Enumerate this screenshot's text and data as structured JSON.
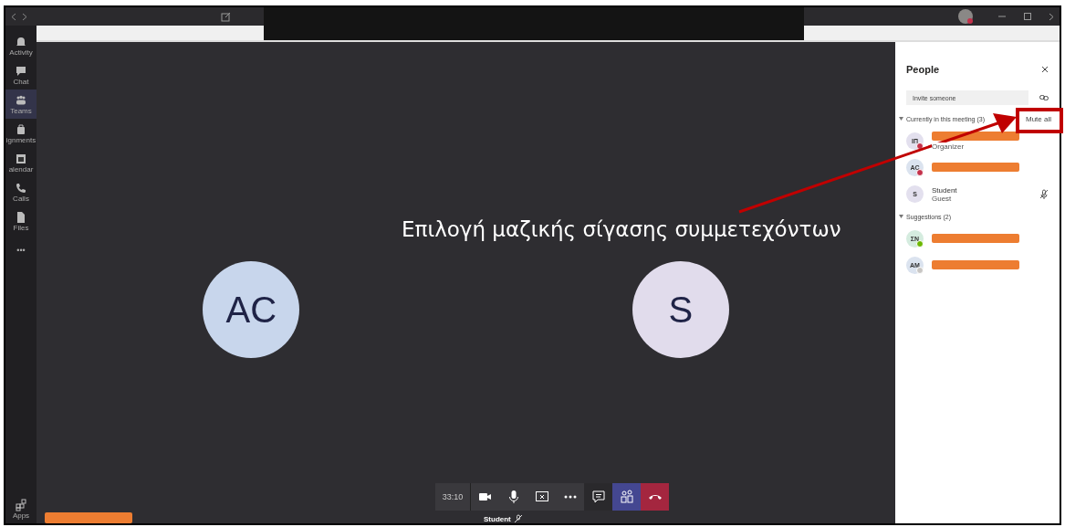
{
  "rail": [
    {
      "label": "Activity",
      "selected": false
    },
    {
      "label": "Chat",
      "selected": false
    },
    {
      "label": "Teams",
      "selected": true
    },
    {
      "label": "ignments",
      "selected": false
    },
    {
      "label": "alendar",
      "selected": false
    },
    {
      "label": "Calls",
      "selected": false
    },
    {
      "label": "Files",
      "selected": false
    },
    {
      "label": "•••",
      "selected": false
    }
  ],
  "rail_bottom": {
    "label": "Apps"
  },
  "stage": {
    "participants": [
      {
        "initials": "AC",
        "kind": "blue"
      },
      {
        "initials": "S",
        "kind": "lilac"
      }
    ],
    "annotation": "Επιλογή μαζικής σίγασης συμμετεχόντων",
    "timer": "33:10",
    "controls": [
      {
        "kind": "plain"
      },
      {
        "kind": "plain"
      },
      {
        "kind": "plain"
      },
      {
        "kind": "plain"
      },
      {
        "kind": "dark"
      },
      {
        "kind": "active"
      },
      {
        "kind": "danger"
      }
    ],
    "self_name": "Student"
  },
  "people": {
    "title": "People",
    "invite_placeholder": "Invite someone",
    "mute_all": "Mute all",
    "sections": [
      {
        "title": "Currently in this meeting (3)",
        "expanded": true,
        "members": [
          {
            "initials": "ΙΠ",
            "redacted": true,
            "role": "Organizer",
            "color": "#c4314b",
            "kind": "lilac"
          },
          {
            "initials": "AC",
            "redacted": true,
            "color": "#c4314b",
            "kind": "blue"
          },
          {
            "initials": "S",
            "name": "Student",
            "role": "Guest",
            "muted": true,
            "kind": "lilac"
          }
        ]
      },
      {
        "title": "Suggestions (2)",
        "expanded": true,
        "members": [
          {
            "initials": "ΣΝ",
            "redacted": true,
            "color": "#6bb700",
            "kind": "green"
          },
          {
            "initials": "AM",
            "redacted": true,
            "color": "#c8c6c4",
            "kind": "blue"
          }
        ]
      }
    ]
  }
}
